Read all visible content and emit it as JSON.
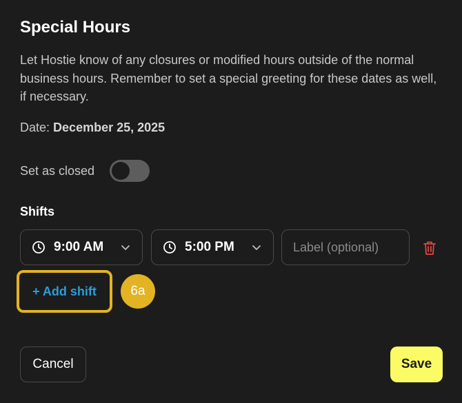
{
  "dialog": {
    "title": "Special Hours",
    "description": "Let Hostie know of any closures or modified hours outside of the normal business hours. Remember to set a special greeting for these dates as well, if necessary.",
    "date_label": "Date:",
    "date_value": "December 25, 2025"
  },
  "closed": {
    "label": "Set as closed",
    "on": false
  },
  "shifts": {
    "label": "Shifts",
    "start_time": "9:00 AM",
    "end_time": "5:00 PM",
    "label_placeholder": "Label (optional)",
    "add_label": "+ Add shift"
  },
  "annotation": {
    "step_badge": "6a",
    "highlight_color": "#e2b323"
  },
  "actions": {
    "cancel_label": "Cancel",
    "save_label": "Save"
  },
  "colors": {
    "background": "#1c1c1c",
    "accent_link": "#2d9cdb",
    "save_button": "#fbfb66",
    "delete_icon": "#e5443f"
  }
}
